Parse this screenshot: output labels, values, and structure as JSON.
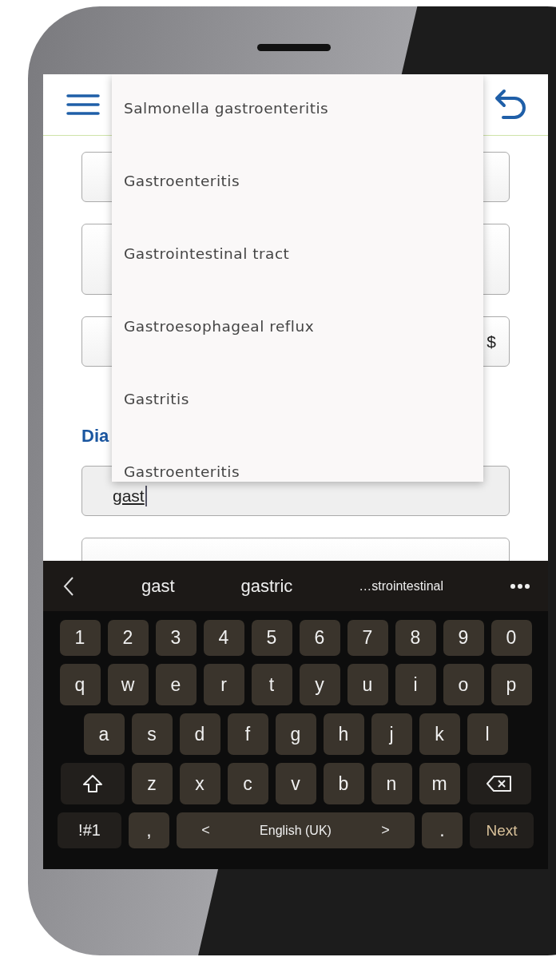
{
  "form": [
    {
      "kind": "field"
    },
    {
      "kind": "tall_field"
    },
    {
      "kind": "field",
      "suffix": "$"
    },
    {
      "kind": "heading",
      "text": "Dia"
    },
    {
      "kind": "input",
      "value": "gast",
      "composing": true
    },
    {
      "kind": "field"
    }
  ],
  "dropdown": {
    "items": [
      "Salmonella gastroenteritis",
      "Gastroenteritis",
      "Gastrointestinal tract",
      "Gastroesophageal reflux",
      "Gastritis",
      "Gastroenteritis"
    ]
  },
  "keyboard": {
    "suggestions": [
      "gast",
      "gastric",
      "…strointestinal"
    ],
    "rows": [
      [
        {
          "kind": "char",
          "label": "1"
        },
        {
          "kind": "char",
          "label": "2"
        },
        {
          "kind": "char",
          "label": "3"
        },
        {
          "kind": "char",
          "label": "4"
        },
        {
          "kind": "char",
          "label": "5"
        },
        {
          "kind": "char",
          "label": "6"
        },
        {
          "kind": "char",
          "label": "7"
        },
        {
          "kind": "char",
          "label": "8"
        },
        {
          "kind": "char",
          "label": "9"
        },
        {
          "kind": "char",
          "label": "0"
        }
      ],
      [
        {
          "kind": "char",
          "label": "q"
        },
        {
          "kind": "char",
          "label": "w"
        },
        {
          "kind": "char",
          "label": "e"
        },
        {
          "kind": "char",
          "label": "r"
        },
        {
          "kind": "char",
          "label": "t"
        },
        {
          "kind": "char",
          "label": "y"
        },
        {
          "kind": "char",
          "label": "u"
        },
        {
          "kind": "char",
          "label": "i"
        },
        {
          "kind": "char",
          "label": "o"
        },
        {
          "kind": "char",
          "label": "p"
        }
      ],
      [
        {
          "kind": "char",
          "label": "a"
        },
        {
          "kind": "char",
          "label": "s"
        },
        {
          "kind": "char",
          "label": "d"
        },
        {
          "kind": "char",
          "label": "f"
        },
        {
          "kind": "char",
          "label": "g"
        },
        {
          "kind": "char",
          "label": "h"
        },
        {
          "kind": "char",
          "label": "j"
        },
        {
          "kind": "char",
          "label": "k"
        },
        {
          "kind": "char",
          "label": "l"
        }
      ],
      [
        {
          "kind": "shift"
        },
        {
          "kind": "char",
          "label": "z"
        },
        {
          "kind": "char",
          "label": "x"
        },
        {
          "kind": "char",
          "label": "c"
        },
        {
          "kind": "char",
          "label": "v"
        },
        {
          "kind": "char",
          "label": "b"
        },
        {
          "kind": "char",
          "label": "n"
        },
        {
          "kind": "char",
          "label": "m"
        },
        {
          "kind": "backspace"
        }
      ]
    ],
    "bottom_row": {
      "symbols": "!#1",
      "comma": ",",
      "space": {
        "left": "<",
        "label": "English (UK)",
        "right": ">"
      },
      "period": ".",
      "next": "Next"
    }
  }
}
